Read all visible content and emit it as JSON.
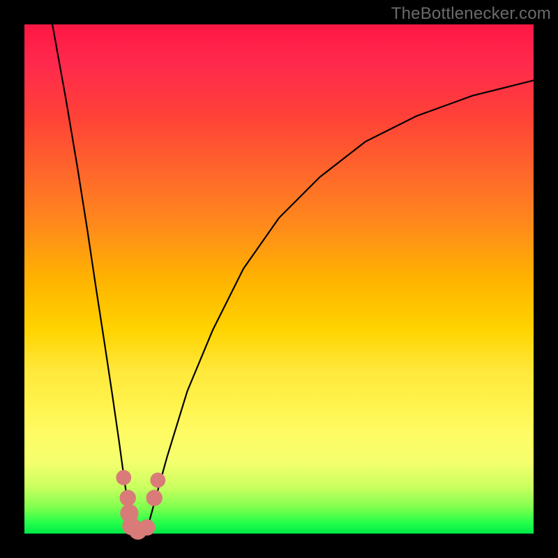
{
  "watermark": "TheBottlenecker.com",
  "colors": {
    "gradient_top": "#ff1744",
    "gradient_mid": "#ffd400",
    "gradient_bottom": "#00e846",
    "curve": "#000000",
    "marker": "#d97b79",
    "frame": "#000000"
  },
  "chart_data": {
    "type": "line",
    "title": "",
    "xlabel": "",
    "ylabel": "",
    "xlim": [
      0,
      100
    ],
    "ylim": [
      0,
      100
    ],
    "grid": false,
    "note": "No numeric axes or tick labels are rendered; values below are the (x%, y%) path coordinates of the two visible curves within the gradient plot area (y=0 at bottom).",
    "series": [
      {
        "name": "left_curve",
        "points": [
          {
            "x": 5.5,
            "y": 100
          },
          {
            "x": 8.2,
            "y": 85
          },
          {
            "x": 10.4,
            "y": 72
          },
          {
            "x": 12.3,
            "y": 60
          },
          {
            "x": 14.1,
            "y": 48
          },
          {
            "x": 15.8,
            "y": 37
          },
          {
            "x": 17.3,
            "y": 27
          },
          {
            "x": 18.6,
            "y": 18
          },
          {
            "x": 19.7,
            "y": 10
          },
          {
            "x": 20.6,
            "y": 4
          },
          {
            "x": 21.2,
            "y": 0.5
          }
        ]
      },
      {
        "name": "right_curve",
        "points": [
          {
            "x": 24.0,
            "y": 0.5
          },
          {
            "x": 25.5,
            "y": 6
          },
          {
            "x": 28.0,
            "y": 15
          },
          {
            "x": 32.0,
            "y": 28
          },
          {
            "x": 37.0,
            "y": 40
          },
          {
            "x": 43.0,
            "y": 52
          },
          {
            "x": 50.0,
            "y": 62
          },
          {
            "x": 58.0,
            "y": 70
          },
          {
            "x": 67.0,
            "y": 77
          },
          {
            "x": 77.0,
            "y": 82
          },
          {
            "x": 88.0,
            "y": 86
          },
          {
            "x": 100.0,
            "y": 89
          }
        ]
      }
    ],
    "markers": [
      {
        "x": 19.5,
        "y": 11,
        "r": 1.5
      },
      {
        "x": 20.3,
        "y": 7,
        "r": 1.6
      },
      {
        "x": 20.6,
        "y": 4,
        "r": 1.8
      },
      {
        "x": 21.0,
        "y": 1.5,
        "r": 1.8
      },
      {
        "x": 22.3,
        "y": 0.6,
        "r": 1.8
      },
      {
        "x": 24.1,
        "y": 1.2,
        "r": 1.6
      },
      {
        "x": 25.5,
        "y": 7,
        "r": 1.6
      },
      {
        "x": 26.2,
        "y": 10.5,
        "r": 1.5
      }
    ]
  }
}
